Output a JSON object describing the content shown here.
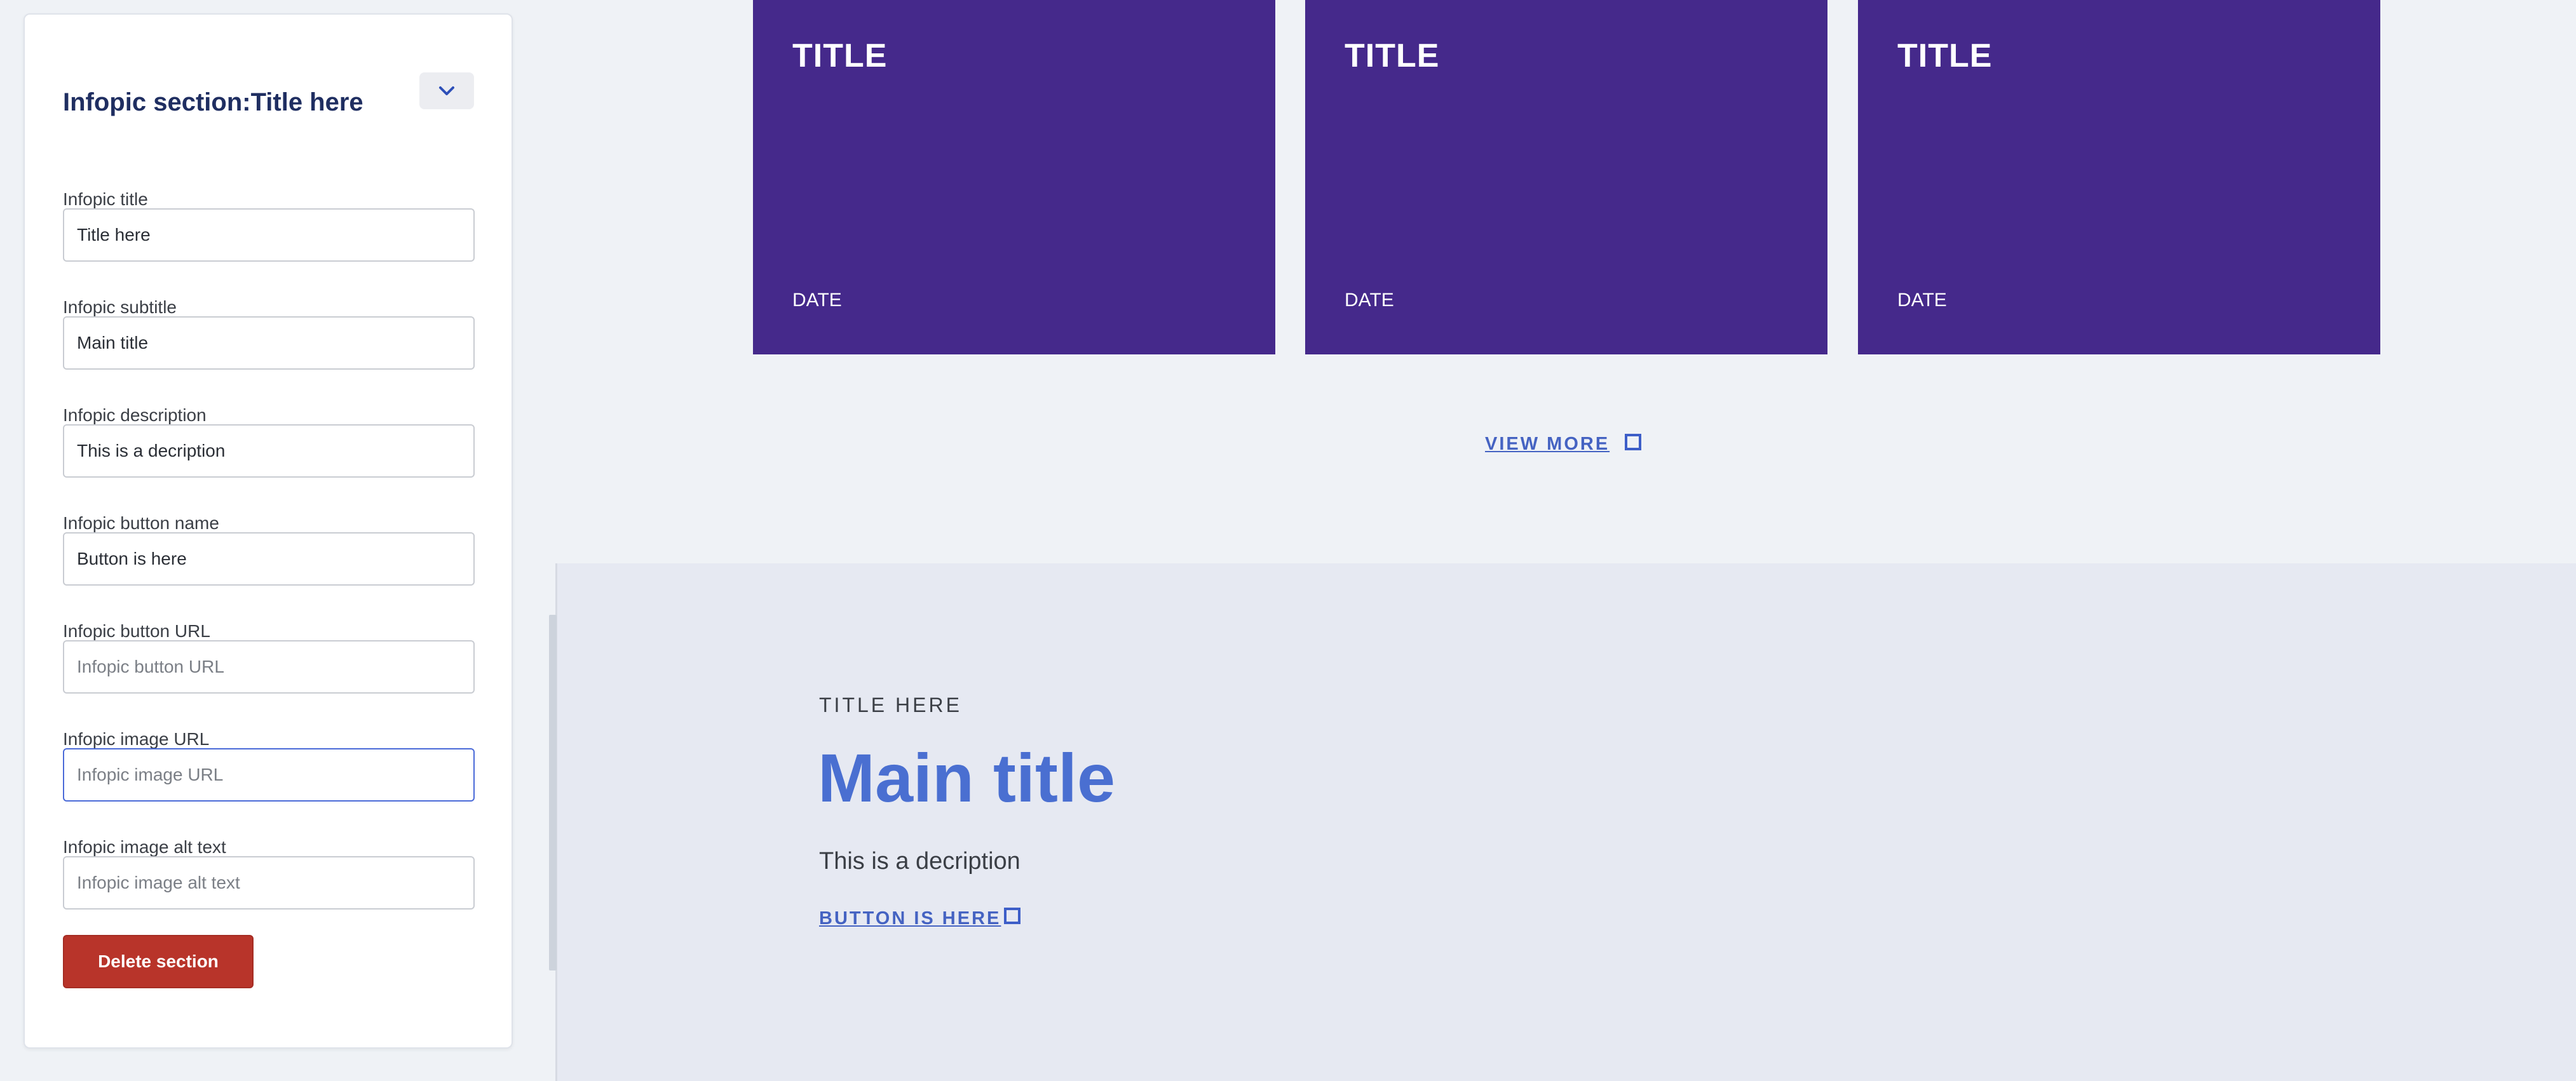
{
  "panel": {
    "title": "Infopic section:Title here",
    "fields": [
      {
        "label": "Infopic title",
        "value": "Title here",
        "placeholder": ""
      },
      {
        "label": "Infopic subtitle",
        "value": "Main title",
        "placeholder": ""
      },
      {
        "label": "Infopic description",
        "value": "This is a decription",
        "placeholder": ""
      },
      {
        "label": "Infopic button name",
        "value": "Button is here",
        "placeholder": ""
      },
      {
        "label": "Infopic button URL",
        "value": "",
        "placeholder": "Infopic button URL"
      },
      {
        "label": "Infopic image URL",
        "value": "",
        "placeholder": "Infopic image URL"
      },
      {
        "label": "Infopic image alt text",
        "value": "",
        "placeholder": "Infopic image alt text"
      }
    ],
    "delete_label": "Delete section"
  },
  "cards": [
    {
      "title": "TITLE",
      "date": "DATE"
    },
    {
      "title": "TITLE",
      "date": "DATE"
    },
    {
      "title": "TITLE",
      "date": "DATE"
    }
  ],
  "view_more_label": "VIEW MORE",
  "infopic": {
    "title": "TITLE HERE",
    "main_title": "Main title",
    "description": "This is a decription",
    "button_label": "BUTTON IS HERE"
  },
  "icons": {
    "collapse": "chevron-down-icon",
    "link_external": "square-icon"
  },
  "colors": {
    "card_bg": "#45298b",
    "accent": "#4a6fd1",
    "danger": "#b8342a",
    "panel_title": "#1f2e61"
  }
}
